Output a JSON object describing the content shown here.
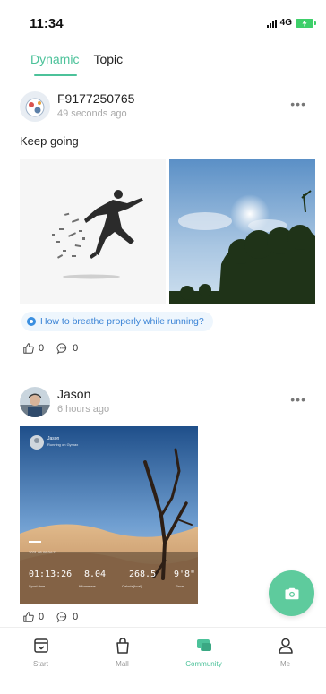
{
  "status_bar": {
    "time": "11:34",
    "network": "4G"
  },
  "tabs": [
    {
      "label": "Dynamic",
      "active": true
    },
    {
      "label": "Topic",
      "active": false
    }
  ],
  "posts": [
    {
      "username": "F9177250765",
      "time": "49 seconds ago",
      "text": "Keep going",
      "topic": "How to breathe properly while running?",
      "likes": "0",
      "comments": "0",
      "more": "•••"
    },
    {
      "username": "Jason",
      "time": "6 hours ago",
      "likes": "0",
      "comments": "0",
      "more": "•••",
      "overlay": {
        "name": "Jason",
        "subtitle": "Running on Gymax",
        "date": "2021-05-09 04:11",
        "stats": [
          {
            "value": "01:13:26",
            "label": "Sport time"
          },
          {
            "value": "8.04",
            "label": "Kilometers"
          },
          {
            "value": "268.5",
            "label": "Calorie(kcal)"
          },
          {
            "value": "9'8\"",
            "label": "Pace"
          }
        ]
      }
    }
  ],
  "bottom_nav": [
    {
      "label": "Start",
      "icon": "start-icon",
      "active": false
    },
    {
      "label": "Mall",
      "icon": "shopping-bag-icon",
      "active": false
    },
    {
      "label": "Community",
      "icon": "community-icon",
      "active": true
    },
    {
      "label": "Me",
      "icon": "person-icon",
      "active": false
    }
  ],
  "colors": {
    "accent": "#4cc29a",
    "fab": "#5ecb9d",
    "topic_text": "#3b84d6"
  }
}
